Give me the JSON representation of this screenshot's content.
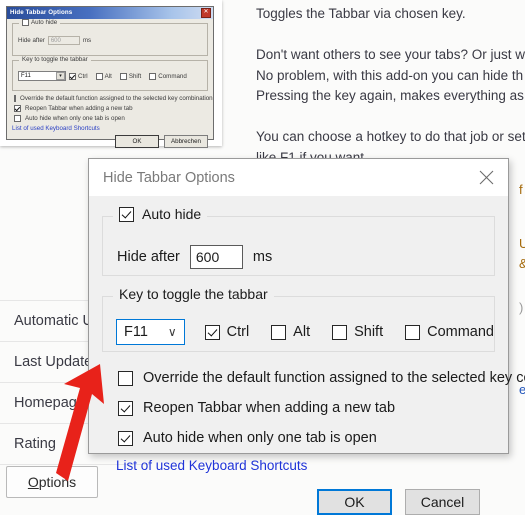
{
  "background": {
    "description_lines": [
      "Toggles the Tabbar via chosen key.",
      "",
      "Don't want others to see your tabs? Or just wa",
      "No problem, with this add-on you can hide th",
      "Pressing the key again, makes everything as it",
      "",
      "You can choose a hotkey to do that job or set",
      "like F1 if you want."
    ],
    "info_rows": [
      "Automatic U",
      "Last Update",
      "Homepag",
      "Rating"
    ],
    "edge_fragments": [
      "f",
      "U",
      "&",
      ")",
      "e"
    ],
    "options_button": {
      "accel": "O",
      "rest": "ptions"
    }
  },
  "old_screenshot": {
    "title": "Hide Tabbar Options",
    "close_glyph": "✕",
    "autohide": {
      "legend": "Auto hide",
      "checked": false,
      "hide_after_label": "Hide after",
      "hide_after_value": "600",
      "unit": "ms"
    },
    "key_group": {
      "legend": "Key to toggle the tabbar",
      "selected_key": "F11",
      "dropdown_glyph": "▾",
      "modifiers": [
        {
          "label": "Ctrl",
          "checked": true
        },
        {
          "label": "Alt",
          "checked": false
        },
        {
          "label": "Shift",
          "checked": false
        },
        {
          "label": "Command",
          "checked": false
        }
      ]
    },
    "checkboxes": [
      {
        "label": "Override the default function assigned to the selected key combination",
        "checked": false
      },
      {
        "label": "Reopen Tabbar when adding a new tab",
        "checked": true
      },
      {
        "label": "Auto hide when only one tab is open",
        "checked": false
      }
    ],
    "link": "List of used Keyboard Shortcuts",
    "buttons": {
      "ok": "OK",
      "cancel": "Abbrechen"
    }
  },
  "dialog": {
    "title": "Hide Tabbar Options",
    "close_icon": "close-icon",
    "autohide": {
      "legend": "Auto hide",
      "checked": true,
      "hide_after_label": "Hide after",
      "hide_after_value": "600",
      "unit": "ms"
    },
    "key_group": {
      "legend": "Key to toggle the tabbar",
      "selected_key": "F11",
      "dropdown_glyph": "∨",
      "modifiers": [
        {
          "label": "Ctrl",
          "checked": true
        },
        {
          "label": "Alt",
          "checked": false
        },
        {
          "label": "Shift",
          "checked": false
        },
        {
          "label": "Command",
          "checked": false
        }
      ]
    },
    "checkboxes": [
      {
        "label": "Override the default function assigned to the selected key combination",
        "checked": false
      },
      {
        "label": "Reopen Tabbar when adding a new tab",
        "checked": true
      },
      {
        "label": "Auto hide when only one tab is open",
        "checked": true
      }
    ],
    "link": "List of used Keyboard Shortcuts",
    "buttons": {
      "ok": "OK",
      "cancel": "Cancel"
    }
  },
  "annotation": {
    "arrow_color": "#e8221a",
    "points_to": "auto-hide-when-only-one-tab-checkbox"
  }
}
